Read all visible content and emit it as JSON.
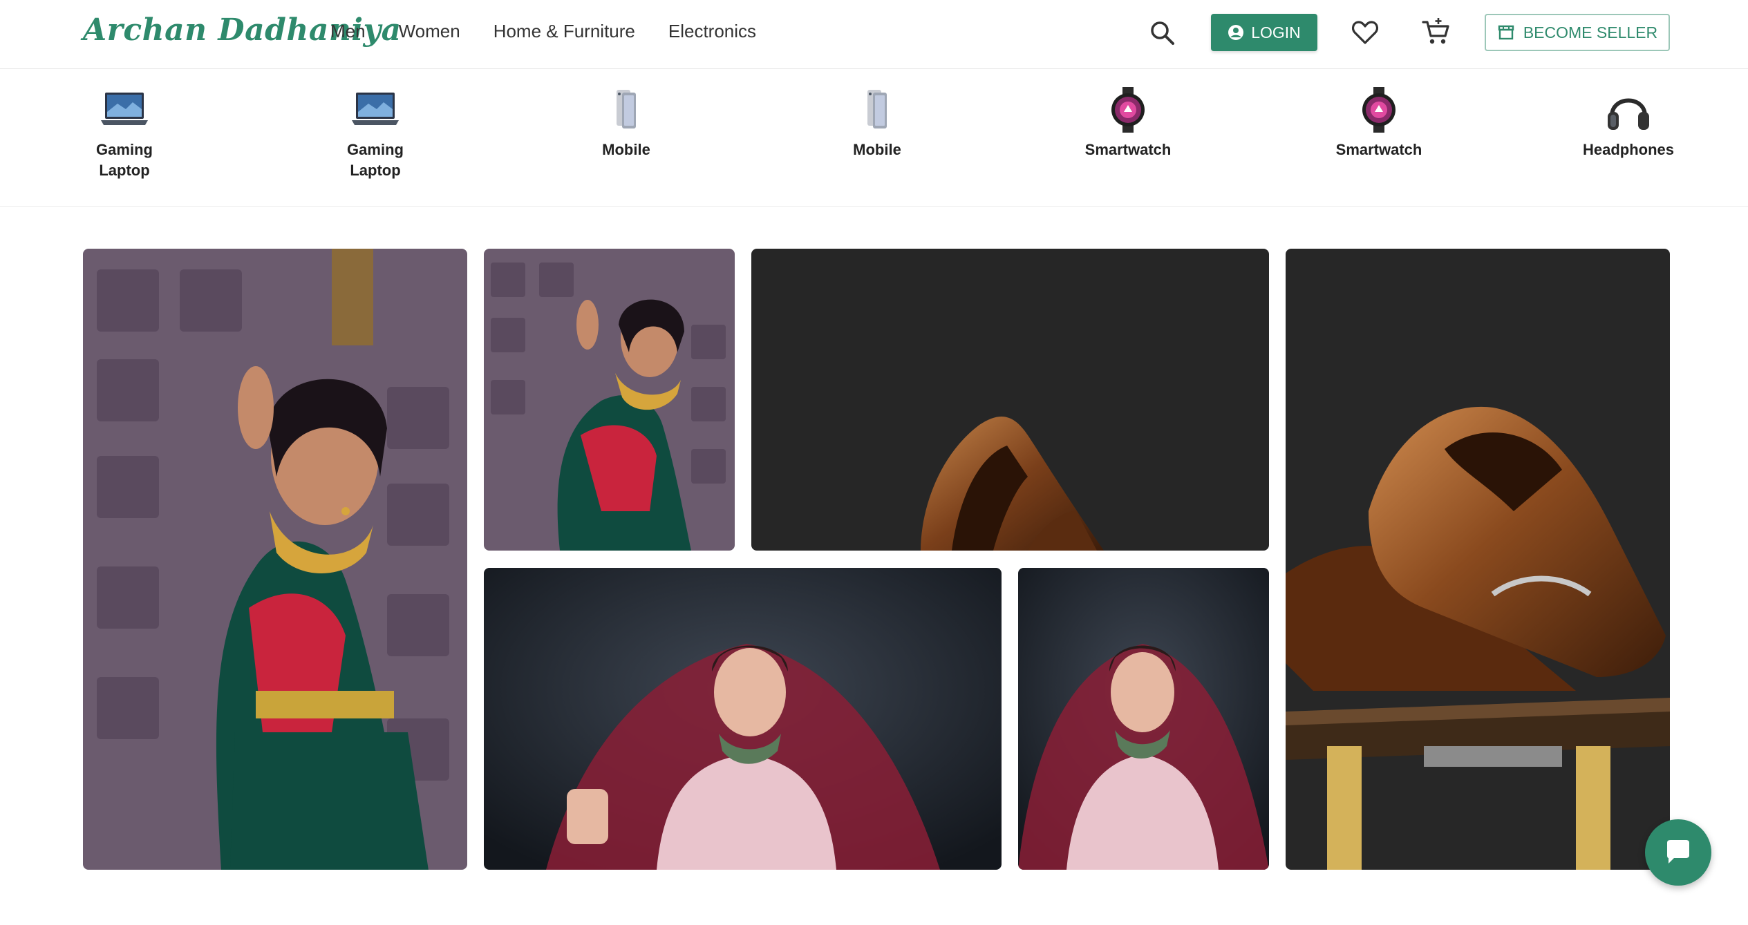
{
  "brand": {
    "name": "Archan Dadhaniya",
    "accent": "#2e8a6c"
  },
  "nav": {
    "items": [
      "Men",
      "Women",
      "Home & Furniture",
      "Electronics"
    ]
  },
  "header": {
    "search_icon": "search-icon",
    "login_label": "LOGIN",
    "wishlist_icon": "heart-icon",
    "cart_icon": "cart-icon",
    "seller_label": "BECOME SELLER"
  },
  "categories": [
    {
      "label": "Gaming Laptop",
      "icon": "laptop"
    },
    {
      "label": "Gaming Laptop",
      "icon": "laptop"
    },
    {
      "label": "Mobile",
      "icon": "phone"
    },
    {
      "label": "Mobile",
      "icon": "phone"
    },
    {
      "label": "Smartwatch",
      "icon": "watch"
    },
    {
      "label": "Smartwatch",
      "icon": "watch"
    },
    {
      "label": "Headphones",
      "icon": "headphones"
    }
  ],
  "gallery": [
    {
      "subject": "saree-woman"
    },
    {
      "subject": "saree-woman"
    },
    {
      "subject": "brown-loafers"
    },
    {
      "subject": "brown-loafers"
    },
    {
      "subject": "bride-lehenga"
    },
    {
      "subject": "bride-lehenga"
    }
  ],
  "chat": {
    "icon": "chat-icon"
  }
}
